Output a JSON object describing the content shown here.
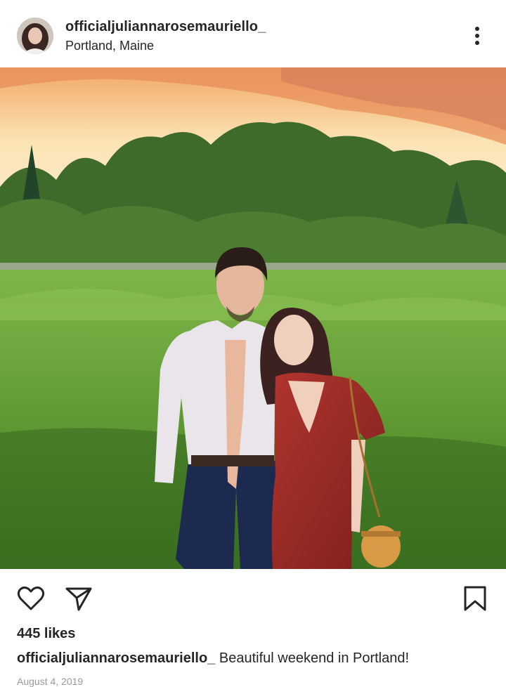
{
  "post": {
    "username": "officialjuliannarosemauriello_",
    "location": "Portland, Maine",
    "likes": "445 likes",
    "caption_user": "officialjuliannarosemauriello_",
    "caption_text": " Beautiful weekend in Portland!",
    "timestamp": "August 4, 2019"
  },
  "icons": {
    "more": "more-options-icon",
    "like": "heart-icon",
    "share": "send-icon",
    "save": "bookmark-icon"
  },
  "colors": {
    "text": "#262626",
    "muted": "#9a9a9a",
    "background": "#ffffff"
  }
}
